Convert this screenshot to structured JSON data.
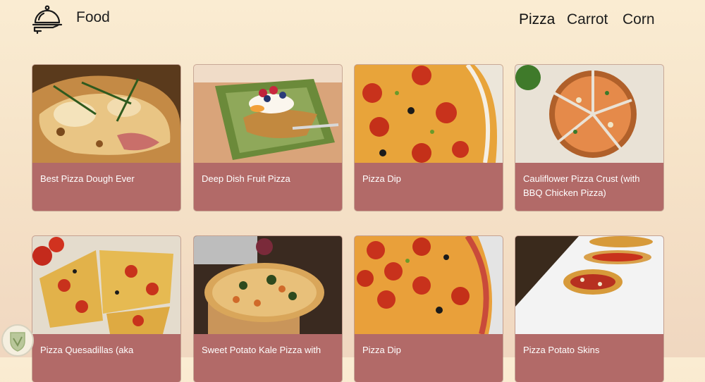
{
  "header": {
    "logo_icon": "food-cloche-icon",
    "brand": "Food",
    "nav": [
      {
        "label": "Pizza",
        "active": true
      },
      {
        "label": "Carrot",
        "active": false
      },
      {
        "label": "Corn",
        "active": false
      }
    ]
  },
  "recipes": [
    {
      "title": "Best Pizza Dough Ever",
      "image": "pizza-dough-photo"
    },
    {
      "title": "Deep Dish Fruit Pizza",
      "image": "fruit-pizza-photo"
    },
    {
      "title": "Pizza Dip",
      "image": "pizza-dip-photo"
    },
    {
      "title": "Cauliflower Pizza Crust (with BBQ Chicken Pizza)",
      "image": "cauliflower-crust-photo"
    },
    {
      "title": "Pizza Quesadillas (aka",
      "image": "pizza-quesadillas-photo"
    },
    {
      "title": "Sweet Potato Kale Pizza with",
      "image": "sweet-potato-kale-pizza-photo"
    },
    {
      "title": "Pizza Dip",
      "image": "pizza-dip-photo-2"
    },
    {
      "title": "Pizza Potato Skins",
      "image": "pizza-potato-skins-photo"
    }
  ],
  "colors": {
    "card_background": "#b26a68",
    "page_gradient_top": "#faecd2",
    "page_gradient_bottom": "#f0d7c0"
  },
  "watermark_icon": "leaf-shield-icon"
}
